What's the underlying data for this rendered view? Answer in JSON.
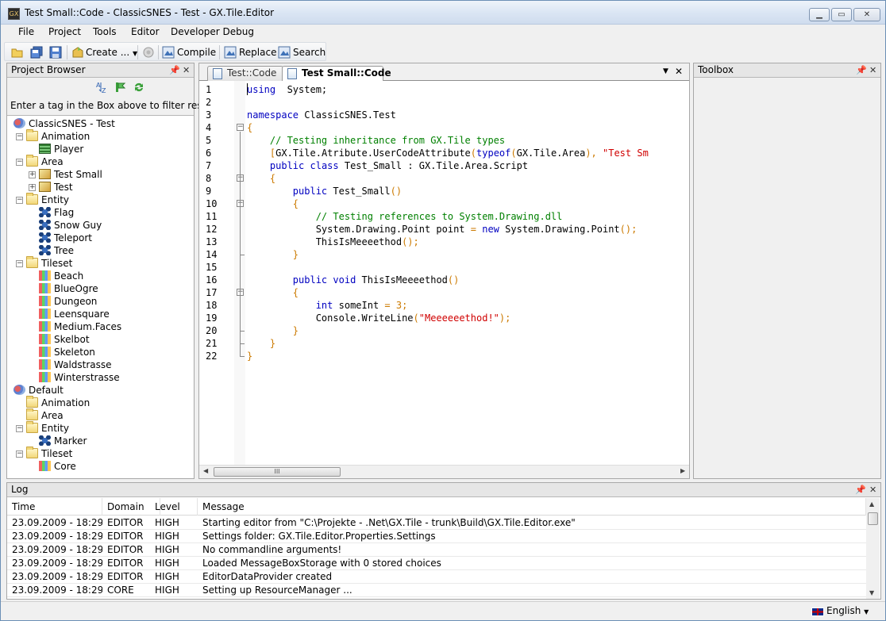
{
  "window": {
    "title": "Test Small::Code - ClassicSNES - Test - GX.Tile.Editor",
    "app_icon_text": "GX"
  },
  "menu": [
    "File",
    "Project",
    "Tools",
    "Editor",
    "Developer Debug"
  ],
  "toolbar": {
    "create_label": "Create ...",
    "compile_label": "Compile",
    "replace_label": "Replace",
    "search_label": "Search"
  },
  "project_browser": {
    "title": "Project Browser",
    "filter_hint": "Enter a tag in the Box above to filter results",
    "tree": [
      {
        "label": "ClassicSNES - Test",
        "level": 0,
        "type": "project"
      },
      {
        "label": "Animation",
        "level": 1,
        "type": "folder",
        "expanded": true
      },
      {
        "label": "Player",
        "level": 2,
        "type": "animation"
      },
      {
        "label": "Area",
        "level": 1,
        "type": "folder",
        "expanded": true
      },
      {
        "label": "Test Small",
        "level": 2,
        "type": "area",
        "expandable": true
      },
      {
        "label": "Test",
        "level": 2,
        "type": "area",
        "expandable": true
      },
      {
        "label": "Entity",
        "level": 1,
        "type": "folder",
        "expanded": true
      },
      {
        "label": "Flag",
        "level": 2,
        "type": "entity"
      },
      {
        "label": "Snow Guy",
        "level": 2,
        "type": "entity"
      },
      {
        "label": "Teleport",
        "level": 2,
        "type": "entity"
      },
      {
        "label": "Tree",
        "level": 2,
        "type": "entity"
      },
      {
        "label": "Tileset",
        "level": 1,
        "type": "folder",
        "expanded": true
      },
      {
        "label": "Beach",
        "level": 2,
        "type": "tileset"
      },
      {
        "label": "BlueOgre",
        "level": 2,
        "type": "tileset"
      },
      {
        "label": "Dungeon",
        "level": 2,
        "type": "tileset"
      },
      {
        "label": "Leensquare",
        "level": 2,
        "type": "tileset"
      },
      {
        "label": "Medium.Faces",
        "level": 2,
        "type": "tileset"
      },
      {
        "label": "Skelbot",
        "level": 2,
        "type": "tileset"
      },
      {
        "label": "Skeleton",
        "level": 2,
        "type": "tileset"
      },
      {
        "label": "Waldstrasse",
        "level": 2,
        "type": "tileset"
      },
      {
        "label": "Winterstrasse",
        "level": 2,
        "type": "tileset"
      },
      {
        "label": "Default",
        "level": 0,
        "type": "project"
      },
      {
        "label": "Animation",
        "level": 1,
        "type": "folder"
      },
      {
        "label": "Area",
        "level": 1,
        "type": "folder"
      },
      {
        "label": "Entity",
        "level": 1,
        "type": "folder",
        "expanded": true
      },
      {
        "label": "Marker",
        "level": 2,
        "type": "entity"
      },
      {
        "label": "Tileset",
        "level": 1,
        "type": "folder",
        "expanded": true
      },
      {
        "label": "Core",
        "level": 2,
        "type": "tileset"
      }
    ]
  },
  "editor": {
    "tabs": [
      {
        "label": "Test::Code",
        "active": false
      },
      {
        "label": "Test Small::Code",
        "active": true
      }
    ],
    "lines": [
      {
        "n": "1",
        "tokens": [
          [
            "kw",
            "using"
          ],
          [
            "",
            "  System;"
          ]
        ]
      },
      {
        "n": "2",
        "tokens": []
      },
      {
        "n": "3",
        "tokens": [
          [
            "kw",
            "namespace"
          ],
          [
            "",
            " ClassicSNES.Test"
          ]
        ]
      },
      {
        "n": "4",
        "tokens": [
          [
            "op",
            "{"
          ]
        ]
      },
      {
        "n": "5",
        "tokens": [
          [
            "",
            "    "
          ],
          [
            "cm",
            "// Testing inheritance from GX.Tile types"
          ]
        ]
      },
      {
        "n": "6",
        "tokens": [
          [
            "",
            "    "
          ],
          [
            "op",
            "["
          ],
          [
            "",
            "GX.Tile.Atribute.UserCodeAttribute"
          ],
          [
            "op",
            "("
          ],
          [
            "kw",
            "typeof"
          ],
          [
            "op",
            "("
          ],
          [
            "",
            "GX.Tile.Area"
          ],
          [
            "op",
            "),"
          ],
          [
            "",
            " "
          ],
          [
            "st",
            "\"Test Sm"
          ]
        ]
      },
      {
        "n": "7",
        "tokens": [
          [
            "",
            "    "
          ],
          [
            "kw",
            "public"
          ],
          [
            "",
            " "
          ],
          [
            "kw",
            "class"
          ],
          [
            "",
            " Test_Small : GX.Tile.Area.Script"
          ]
        ]
      },
      {
        "n": "8",
        "tokens": [
          [
            "",
            "    "
          ],
          [
            "op",
            "{"
          ]
        ]
      },
      {
        "n": "9",
        "tokens": [
          [
            "",
            "        "
          ],
          [
            "kw",
            "public"
          ],
          [
            "",
            " Test_Small"
          ],
          [
            "op",
            "()"
          ]
        ]
      },
      {
        "n": "10",
        "tokens": [
          [
            "",
            "        "
          ],
          [
            "op",
            "{"
          ]
        ]
      },
      {
        "n": "11",
        "tokens": [
          [
            "",
            "            "
          ],
          [
            "cm",
            "// Testing references to System.Drawing.dll"
          ]
        ]
      },
      {
        "n": "12",
        "tokens": [
          [
            "",
            "            System.Drawing.Point point "
          ],
          [
            "op",
            "="
          ],
          [
            "",
            " "
          ],
          [
            "kw",
            "new"
          ],
          [
            "",
            " System.Drawing.Point"
          ],
          [
            "op",
            "();"
          ]
        ]
      },
      {
        "n": "13",
        "tokens": [
          [
            "",
            "            ThisIsMeeeethod"
          ],
          [
            "op",
            "();"
          ]
        ]
      },
      {
        "n": "14",
        "tokens": [
          [
            "",
            "        "
          ],
          [
            "op",
            "}"
          ]
        ]
      },
      {
        "n": "15",
        "tokens": []
      },
      {
        "n": "16",
        "tokens": [
          [
            "",
            "        "
          ],
          [
            "kw",
            "public"
          ],
          [
            "",
            " "
          ],
          [
            "kw",
            "void"
          ],
          [
            "",
            " ThisIsMeeeethod"
          ],
          [
            "op",
            "()"
          ]
        ]
      },
      {
        "n": "17",
        "tokens": [
          [
            "",
            "        "
          ],
          [
            "op",
            "{"
          ]
        ]
      },
      {
        "n": "18",
        "tokens": [
          [
            "",
            "            "
          ],
          [
            "kw",
            "int"
          ],
          [
            "",
            " someInt "
          ],
          [
            "op",
            "="
          ],
          [
            "",
            " "
          ],
          [
            "op",
            "3;"
          ]
        ]
      },
      {
        "n": "19",
        "tokens": [
          [
            "",
            "            Console.WriteLine"
          ],
          [
            "op",
            "("
          ],
          [
            "st",
            "\"Meeeeeethod!\""
          ],
          [
            "op",
            ");"
          ]
        ]
      },
      {
        "n": "20",
        "tokens": [
          [
            "",
            "        "
          ],
          [
            "op",
            "}"
          ]
        ]
      },
      {
        "n": "21",
        "tokens": [
          [
            "",
            "    "
          ],
          [
            "op",
            "}"
          ]
        ]
      },
      {
        "n": "22",
        "tokens": [
          [
            "op",
            "}"
          ]
        ]
      }
    ]
  },
  "toolbox": {
    "title": "Toolbox"
  },
  "log": {
    "title": "Log",
    "columns": [
      "Time",
      "Domain",
      "Level",
      "Message"
    ],
    "rows": [
      [
        "23.09.2009 - 18:29",
        "EDITOR",
        "HIGH",
        "Starting editor from \"C:\\Projekte - .Net\\GX.Tile - trunk\\Build\\GX.Tile.Editor.exe\""
      ],
      [
        "23.09.2009 - 18:29",
        "EDITOR",
        "HIGH",
        "Settings folder: GX.Tile.Editor.Properties.Settings"
      ],
      [
        "23.09.2009 - 18:29",
        "EDITOR",
        "HIGH",
        "No commandline arguments!"
      ],
      [
        "23.09.2009 - 18:29",
        "EDITOR",
        "HIGH",
        "Loaded MessageBoxStorage with 0 stored choices"
      ],
      [
        "23.09.2009 - 18:29",
        "EDITOR",
        "HIGH",
        "EditorDataProvider created"
      ],
      [
        "23.09.2009 - 18:29",
        "CORE",
        "HIGH",
        "Setting up ResourceManager ..."
      ]
    ]
  },
  "statusbar": {
    "language": "English"
  }
}
